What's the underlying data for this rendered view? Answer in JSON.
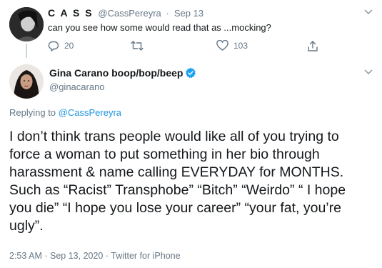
{
  "reply_tweet": {
    "display_name": "C A S S",
    "handle": "@CassPereyra",
    "date": "Sep 13",
    "separator": "·",
    "text": "can you see how some would read that as ...mocking?",
    "replies": "20",
    "likes": "103",
    "icons": [
      "more-chevron-icon",
      "reply-icon",
      "retweet-icon",
      "like-icon",
      "share-icon"
    ]
  },
  "main_tweet": {
    "display_name": "Gina Carano boop/bop/beep",
    "handle": "@ginacarano",
    "replying_prefix": "Replying to",
    "replying_to": "@CassPereyra",
    "text": "I don’t think trans people would like all of you trying to\nforce a woman to put something in her bio through\nharassment & name calling EVERYDAY for MONTHS.\nSuch as “Racist” Transphobe” “Bitch” “Weirdo” “ I hope\nyou die” “I hope you lose your career” “your fat, you’re\nugly”.",
    "time": "2:53 AM",
    "date": "Sep 13, 2020",
    "source": "Twitter for iPhone",
    "icons": [
      "verified-badge-icon",
      "more-chevron-icon"
    ]
  },
  "colors": {
    "accent": "#1da1f2",
    "link": "#1b95e0",
    "muted": "#657786",
    "text": "#14171a"
  }
}
